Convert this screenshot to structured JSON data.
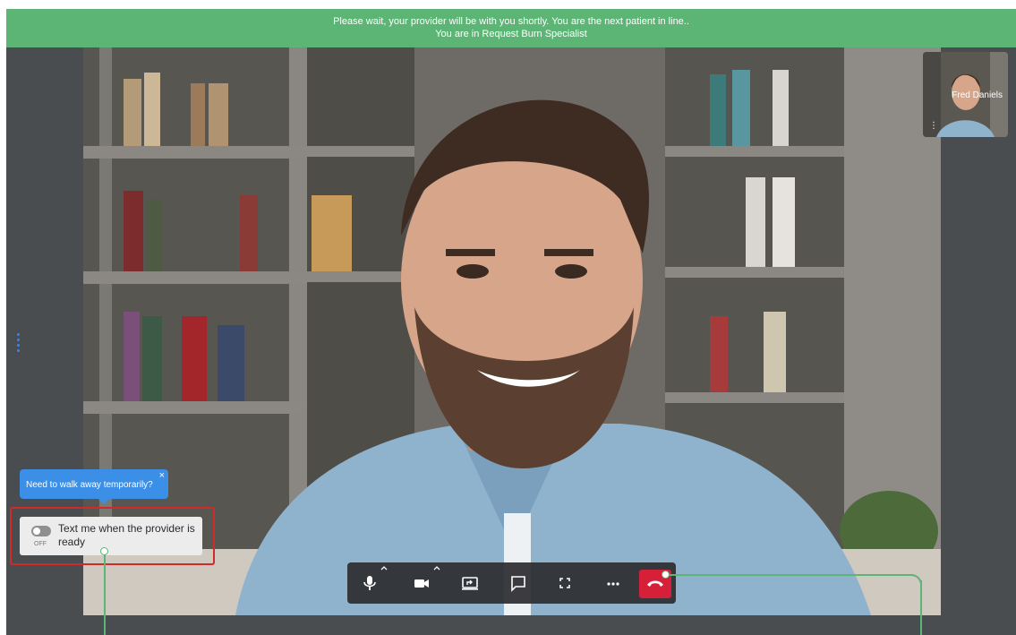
{
  "banner": {
    "line1": "Please wait, your provider will be with you shortly. You are the next patient in line..",
    "line2": "You are in Request Burn Specialist"
  },
  "self_view": {
    "name": "Fred Daniels",
    "menu_icon": "more-vertical-icon"
  },
  "tooltip": {
    "text": "Need to walk away temporarily?",
    "close_glyph": "×"
  },
  "text_me": {
    "toggle_state": "OFF",
    "label": "Text me when the provider is ready"
  },
  "controls": [
    {
      "name": "microphone-button",
      "icon": "microphone-icon",
      "has_caret": true
    },
    {
      "name": "camera-button",
      "icon": "video-camera-icon",
      "has_caret": true
    },
    {
      "name": "share-screen-button",
      "icon": "screen-share-icon",
      "has_caret": false
    },
    {
      "name": "chat-button",
      "icon": "chat-bubble-icon",
      "has_caret": false
    },
    {
      "name": "fullscreen-button",
      "icon": "fullscreen-icon",
      "has_caret": false
    },
    {
      "name": "more-options-button",
      "icon": "more-horizontal-icon",
      "has_caret": false
    },
    {
      "name": "hang-up-button",
      "icon": "phone-hangup-icon",
      "has_caret": false
    }
  ],
  "colors": {
    "banner": "#5cb574",
    "tooltip": "#3c8fe6",
    "highlight_border": "#d02a2a",
    "hangup": "#d6203a",
    "annotation_line": "#5cb574"
  }
}
